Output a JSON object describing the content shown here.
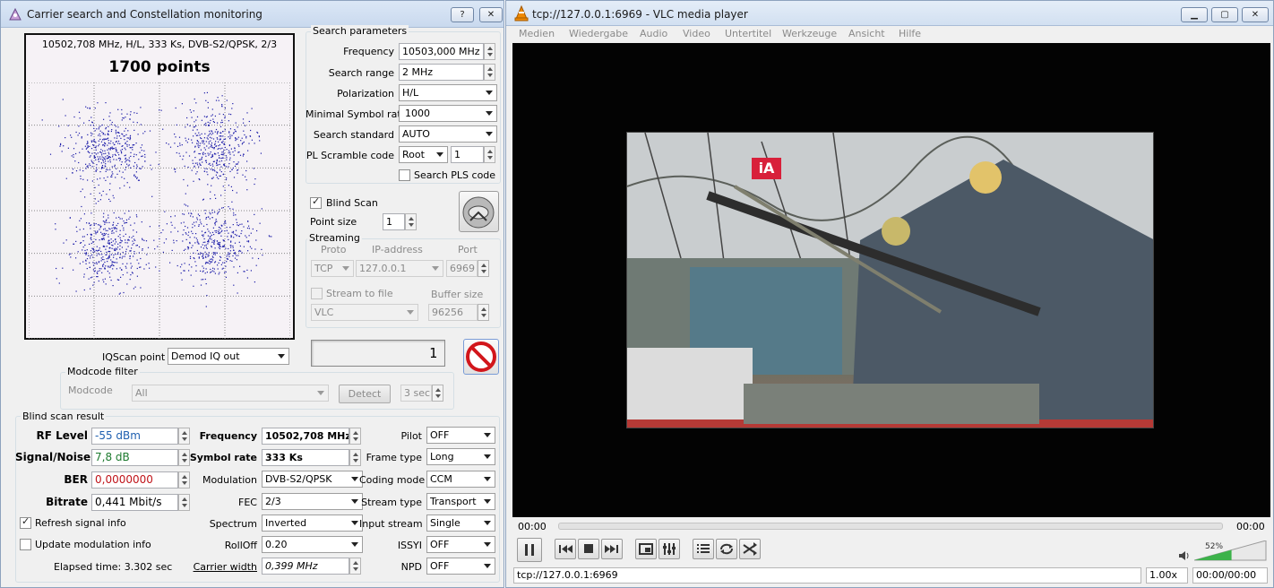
{
  "left_window": {
    "title": "Carrier search and Constellation monitoring",
    "help_btn": "?",
    "close_btn": "✕",
    "constellation": {
      "info": "10502,708 MHz, H/L, 333 Ks, DVB-S2/QPSK, 2/3",
      "points_label": "1700 points"
    },
    "search_params": {
      "title": "Search parameters",
      "frequency_label": "Frequency",
      "frequency_value": "10503,000 MHz",
      "search_range_label": "Search range",
      "search_range_value": "2 MHz",
      "polarization_label": "Polarization",
      "polarization_value": "H/L",
      "min_symbol_rate_label": "Minimal Symbol rate",
      "min_symbol_rate_value": "1000",
      "search_standard_label": "Search standard",
      "search_standard_value": "AUTO",
      "pl_scramble_label": "PL Scramble code",
      "pl_scramble_type": "Root",
      "pl_scramble_value": "1",
      "search_pls_label": "Search PLS code"
    },
    "blind_scan_label": "Blind Scan",
    "point_size_label": "Point size",
    "point_size_value": "1",
    "streaming": {
      "title": "Streaming",
      "proto_header": "Proto",
      "ip_header": "IP-address",
      "port_header": "Port",
      "proto_value": "TCP",
      "ip_value": "127.0.0.1",
      "port_value": "6969",
      "stream_to_file_label": "Stream to file",
      "buffer_size_label": "Buffer size",
      "player_value": "VLC",
      "buffer_value": "96256"
    },
    "counter_value": "1",
    "iqscan_label": "IQScan point",
    "iqscan_value": "Demod IQ out",
    "modcode_filter": {
      "title": "Modcode filter",
      "modcode_label": "Modcode",
      "modcode_value": "All",
      "detect_btn": "Detect",
      "timeout_value": "3 sec"
    },
    "result": {
      "title": "Blind scan result",
      "rf_level_label": "RF Level",
      "rf_level_value": "-55 dBm",
      "snr_label": "Signal/Noise",
      "snr_value": "7,8 dB",
      "ber_label": "BER",
      "ber_value": "0,0000000",
      "bitrate_label": "Bitrate",
      "bitrate_value": "0,441 Mbit/s",
      "refresh_label": "Refresh signal info",
      "update_mod_label": "Update modulation info",
      "elapsed": "Elapsed time: 3.302 sec",
      "frequency_label": "Frequency",
      "frequency_value": "10502,708 MHz",
      "symbol_rate_label": "Symbol rate",
      "symbol_rate_value": "333 Ks",
      "modulation_label": "Modulation",
      "modulation_value": "DVB-S2/QPSK",
      "fec_label": "FEC",
      "fec_value": "2/3",
      "spectrum_label": "Spectrum",
      "spectrum_value": "Inverted",
      "rolloff_label": "RollOff",
      "rolloff_value": "0.20",
      "carrier_width_label": "Carrier width",
      "carrier_width_value": "0,399 MHz",
      "pilot_label": "Pilot",
      "pilot_value": "OFF",
      "frame_type_label": "Frame type",
      "frame_type_value": "Long",
      "coding_mode_label": "Coding mode",
      "coding_mode_value": "CCM",
      "stream_type_label": "Stream type",
      "stream_type_value": "Transport",
      "input_stream_label": "Input stream",
      "input_stream_value": "Single",
      "issyi_label": "ISSYI",
      "issyi_value": "OFF",
      "npd_label": "NPD",
      "npd_value": "OFF"
    }
  },
  "vlc": {
    "title": "tcp://127.0.0.1:6969 - VLC media player",
    "menu": [
      "Medien",
      "Wiedergabe",
      "Audio",
      "Video",
      "Untertitel",
      "Werkzeuge",
      "Ansicht",
      "Hilfe"
    ],
    "overlay_logo": "iA",
    "time_elapsed": "00:00",
    "time_total": "00:00",
    "volume_percent": "52%",
    "volume_level": 0.52,
    "status_url": "tcp://127.0.0.1:6969",
    "speed": "1.00x",
    "time_status": "00:00/00:00"
  }
}
